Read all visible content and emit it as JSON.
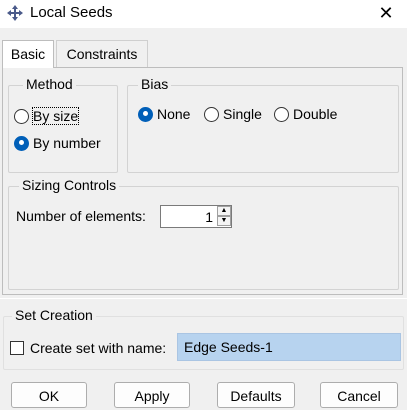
{
  "window": {
    "title": "Local Seeds",
    "icon": "abaqus-icon",
    "close_glyph": "✕"
  },
  "tabs": [
    {
      "label": "Basic",
      "active": true
    },
    {
      "label": "Constraints",
      "active": false
    }
  ],
  "method": {
    "legend": "Method",
    "options": [
      {
        "label": "By size",
        "selected": false
      },
      {
        "label": "By number",
        "selected": true
      }
    ]
  },
  "bias": {
    "legend": "Bias",
    "options": [
      {
        "label": "None",
        "selected": true
      },
      {
        "label": "Single",
        "selected": false
      },
      {
        "label": "Double",
        "selected": false
      }
    ]
  },
  "sizing": {
    "legend": "Sizing Controls",
    "label": "Number of elements:",
    "value": "1"
  },
  "set_creation": {
    "legend": "Set Creation",
    "checkbox_label": "Create set with name:",
    "checked": false,
    "name_value": "Edge Seeds-1"
  },
  "buttons": {
    "ok": "OK",
    "apply": "Apply",
    "defaults": "Defaults",
    "cancel": "Cancel"
  },
  "colors": {
    "accent": "#005fb8",
    "selection": "#b7d3ef"
  }
}
